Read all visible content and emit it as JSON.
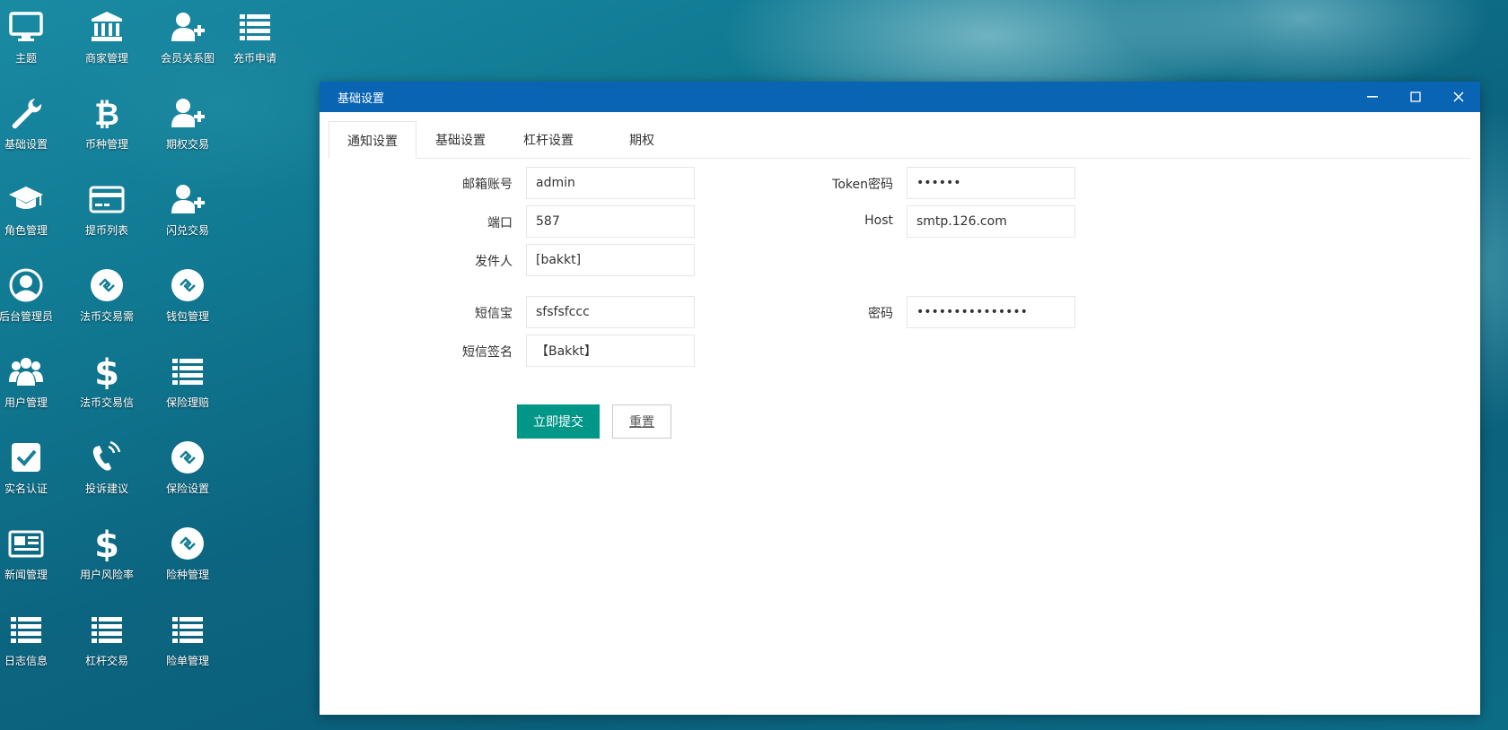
{
  "desktop": {
    "icons": [
      {
        "label": "主题",
        "icon": "monitor-icon"
      },
      {
        "label": "商家管理",
        "icon": "bank-icon"
      },
      {
        "label": "会员关系图",
        "icon": "user-add-icon"
      },
      {
        "label": "充币申请",
        "icon": "list-icon"
      },
      {
        "label": "基础设置",
        "icon": "wrench-icon"
      },
      {
        "label": "币种管理",
        "icon": "bitcoin-icon"
      },
      {
        "label": "期权交易",
        "icon": "user-add-icon"
      },
      {
        "label": "角色管理",
        "icon": "graduation-cap-icon"
      },
      {
        "label": "提币列表",
        "icon": "credit-card-icon"
      },
      {
        "label": "闪兑交易",
        "icon": "user-add-icon"
      },
      {
        "label": "后台管理员",
        "icon": "user-circle-icon"
      },
      {
        "label": "法币交易需",
        "icon": "swap-icon"
      },
      {
        "label": "钱包管理",
        "icon": "swap-icon"
      },
      {
        "label": "用户管理",
        "icon": "users-icon"
      },
      {
        "label": "法币交易信",
        "icon": "dollar-icon"
      },
      {
        "label": "保险理赔",
        "icon": "list-icon"
      },
      {
        "label": "实名认证",
        "icon": "check-square-icon"
      },
      {
        "label": "投诉建议",
        "icon": "phone-icon"
      },
      {
        "label": "保险设置",
        "icon": "swap-icon"
      },
      {
        "label": "新闻管理",
        "icon": "newspaper-icon"
      },
      {
        "label": "用户风险率",
        "icon": "dollar-icon"
      },
      {
        "label": "险种管理",
        "icon": "swap-icon"
      },
      {
        "label": "日志信息",
        "icon": "list-icon"
      },
      {
        "label": "杠杆交易",
        "icon": "list-icon"
      },
      {
        "label": "险单管理",
        "icon": "list-icon"
      }
    ]
  },
  "window": {
    "title": "基础设置",
    "tabs": [
      {
        "label": "通知设置",
        "active": true
      },
      {
        "label": "基础设置",
        "active": false
      },
      {
        "label": "杠杆设置",
        "active": false
      },
      {
        "label": "期权",
        "active": false
      }
    ],
    "form": {
      "email_account": {
        "label": "邮箱账号",
        "value": "admin"
      },
      "token_password": {
        "label": "Token密码",
        "value": "••••••"
      },
      "port": {
        "label": "端口",
        "value": "587"
      },
      "host": {
        "label": "Host",
        "value": "smtp.126.com"
      },
      "sender": {
        "label": "发件人",
        "value": "[bakkt]"
      },
      "sms_bao": {
        "label": "短信宝",
        "value": "sfsfsfccc"
      },
      "password": {
        "label": "密码",
        "value": "•••••••••••••••"
      },
      "sms_signature": {
        "label": "短信签名",
        "value": "【Bakkt】"
      }
    },
    "buttons": {
      "submit": "立即提交",
      "reset": "重置"
    }
  },
  "colors": {
    "titlebar": "#0a64b4",
    "primary": "#009688"
  }
}
